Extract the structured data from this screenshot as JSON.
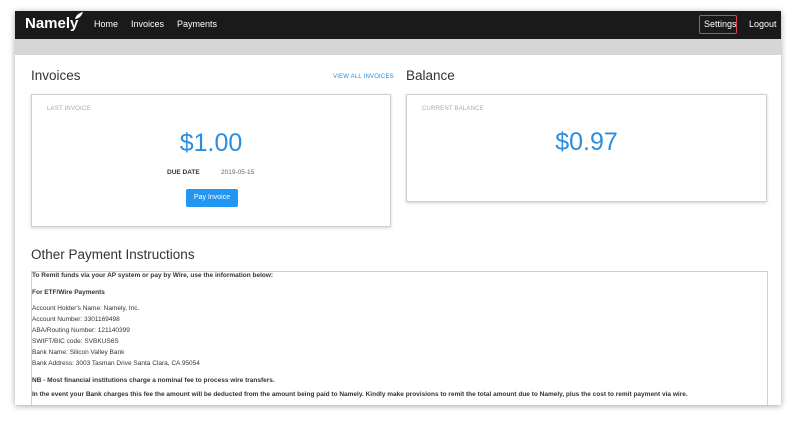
{
  "nav": {
    "brand": "Namely",
    "links": [
      "Home",
      "Invoices",
      "Payments"
    ],
    "settings": "Settings",
    "logout": "Logout"
  },
  "invoices": {
    "title": "Invoices",
    "view_all": "VIEW ALL INVOICES",
    "last_invoice_label": "LAST INVOICE",
    "amount": "$1.00",
    "due_date_label": "DUE DATE",
    "due_date": "2019-05-15",
    "pay_button": "Pay Invoice"
  },
  "balance": {
    "title": "Balance",
    "current_balance_label": "CURRENT BALANCE",
    "amount": "$0.97"
  },
  "instructions": {
    "title": "Other Payment Instructions",
    "intro": "To Remit funds via your AP system or pay by Wire, use the information below:",
    "section_heading": "For ETF/Wire Payments",
    "lines": [
      "Account Holder's Name: Namely, Inc.",
      "Account Number: 3301169498",
      "ABA/Routing Number: 121140399",
      "SWIFT/BIC code: SVBKUS6S",
      "Bank Name: Silicon Valley Bank",
      "Bank Address: 3003 Tasman Drive Santa Clara, CA 95054"
    ],
    "nb": "NB - Most financial institutions charge a nominal fee to process wire transfers.",
    "fee_note": "In the event your Bank charges this fee the amount will be deducted from the amount being paid to Namely. Kindly make provisions to remit the total amount due to Namely, plus the cost to remit payment via wire."
  },
  "colors": {
    "navbar": "#1a1a1a",
    "accent": "#2a8ee0",
    "button": "#2196f3",
    "highlight": "#e0424b"
  }
}
